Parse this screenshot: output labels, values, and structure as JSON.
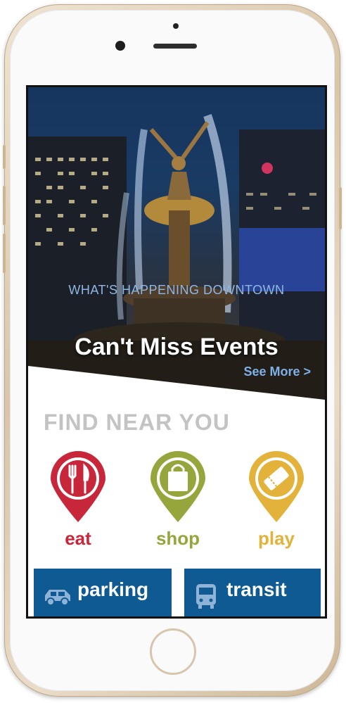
{
  "hero": {
    "subtitle": "WHAT'S HAPPENING DOWNTOWN",
    "title": "Can't Miss Events",
    "see_more": "See More >"
  },
  "find_near_you": {
    "title": "FIND NEAR YOU",
    "categories": [
      {
        "label": "eat",
        "icon": "fork-knife-icon",
        "color": "#c8263a"
      },
      {
        "label": "shop",
        "icon": "shopping-bag-icon",
        "color": "#97a63c"
      },
      {
        "label": "play",
        "icon": "ticket-icon",
        "color": "#e2b23a"
      }
    ]
  },
  "tiles": [
    {
      "label": "parking",
      "icon": "car-icon"
    },
    {
      "label": "transit",
      "icon": "bus-icon"
    }
  ],
  "colors": {
    "tile_blue": "#0f5a93",
    "heading_gray": "#c3c3c3",
    "hero_accent": "#8fb6e4"
  }
}
